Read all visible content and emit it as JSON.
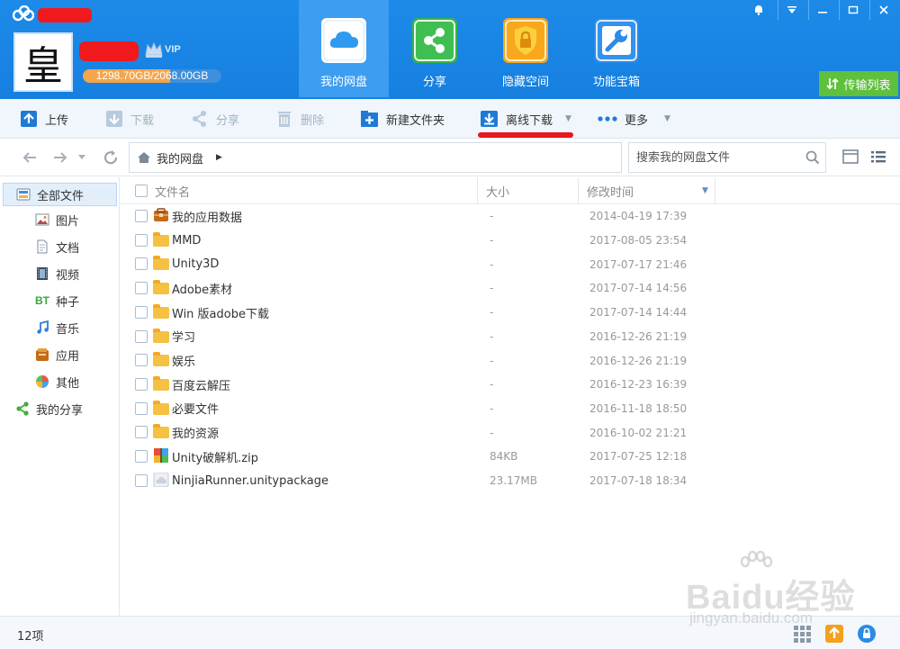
{
  "window": {
    "controls": [
      "bell-icon",
      "dropdown-icon",
      "minimize-icon",
      "restore-icon",
      "close-icon"
    ]
  },
  "user": {
    "avatar_char": "皇",
    "vip_label": "VIP",
    "quota_text": "1298.70GB/2068.00GB",
    "quota_fraction": 0.628
  },
  "main_tabs": [
    {
      "label": "我的网盘",
      "icon": "cloud-icon",
      "active": true
    },
    {
      "label": "分享",
      "icon": "share-icon",
      "active": false
    },
    {
      "label": "隐藏空间",
      "icon": "lock-icon",
      "active": false
    },
    {
      "label": "功能宝箱",
      "icon": "tools-icon",
      "active": false
    }
  ],
  "transfer_list_label": "传输列表",
  "toolbar": {
    "upload": "上传",
    "download": "下载",
    "share": "分享",
    "delete": "删除",
    "new_folder": "新建文件夹",
    "offline_download": "离线下载",
    "more": "更多"
  },
  "address": {
    "crumb": "我的网盘",
    "search_placeholder": "搜索我的网盘文件"
  },
  "sidebar": {
    "items": [
      {
        "label": "全部文件",
        "icon": "all-files-icon",
        "active": true
      },
      {
        "label": "图片",
        "icon": "picture-icon"
      },
      {
        "label": "文档",
        "icon": "document-icon"
      },
      {
        "label": "视频",
        "icon": "video-icon"
      },
      {
        "label": "种子",
        "icon": "bt-icon",
        "badge": "BT"
      },
      {
        "label": "音乐",
        "icon": "music-icon"
      },
      {
        "label": "应用",
        "icon": "app-icon"
      },
      {
        "label": "其他",
        "icon": "other-icon"
      },
      {
        "label": "我的分享",
        "icon": "share-icon"
      }
    ]
  },
  "columns": {
    "name": "文件名",
    "size": "大小",
    "modified": "修改时间"
  },
  "files": [
    {
      "name": "我的应用数据",
      "size": "-",
      "date": "2014-04-19 17:39",
      "icon": "app-data-folder-icon"
    },
    {
      "name": "MMD",
      "size": "-",
      "date": "2017-08-05 23:54",
      "icon": "folder-icon"
    },
    {
      "name": "Unity3D",
      "size": "-",
      "date": "2017-07-17 21:46",
      "icon": "folder-icon"
    },
    {
      "name": "Adobe素材",
      "size": "-",
      "date": "2017-07-14 14:56",
      "icon": "folder-icon"
    },
    {
      "name": "Win 版adobe下载",
      "size": "-",
      "date": "2017-07-14 14:44",
      "icon": "folder-icon"
    },
    {
      "name": "学习",
      "size": "-",
      "date": "2016-12-26 21:19",
      "icon": "folder-icon"
    },
    {
      "name": "娱乐",
      "size": "-",
      "date": "2016-12-26 21:19",
      "icon": "folder-icon"
    },
    {
      "name": "百度云解压",
      "size": "-",
      "date": "2016-12-23 16:39",
      "icon": "folder-icon"
    },
    {
      "name": "必要文件",
      "size": "-",
      "date": "2016-11-18 18:50",
      "icon": "folder-icon"
    },
    {
      "name": "我的资源",
      "size": "-",
      "date": "2016-10-02 21:21",
      "icon": "folder-icon"
    },
    {
      "name": "Unity破解机.zip",
      "size": "84KB",
      "date": "2017-07-25 12:18",
      "icon": "zip-icon"
    },
    {
      "name": "NinjiaRunner.unitypackage",
      "size": "23.17MB",
      "date": "2017-07-18 18:34",
      "icon": "unknown-file-icon"
    }
  ],
  "status": {
    "count": "12项"
  },
  "watermark": {
    "main": "Baidu经验",
    "sub": "jingyan.baidu.com"
  },
  "colors": {
    "header_blue": "#1680e0",
    "active_tab": "#3d9df0",
    "transfer_green": "#5ec03b",
    "highlight_red": "#e8171d",
    "quota_orange": "#f5a54b"
  }
}
